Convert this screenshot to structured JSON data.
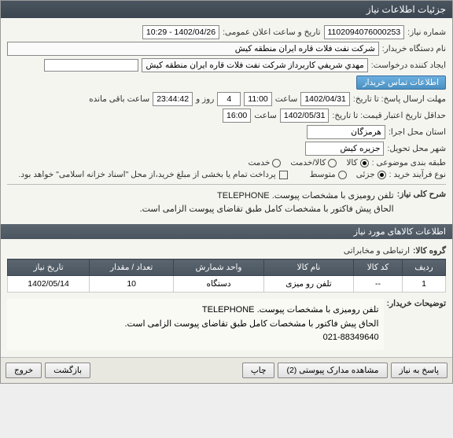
{
  "titlebar": "جزئیات اطلاعات نیاز",
  "labels": {
    "need_no": "شماره نیاز:",
    "announce_date": "تاریخ و ساعت اعلان عمومی:",
    "buyer_org": "نام دستگاه خریدار:",
    "requester": "ایجاد کننده درخواست:",
    "contact_btn": "اطلاعات تماس خریدار",
    "deadline": "مهلت ارسال پاسخ: تا تاریخ:",
    "hour": "ساعت",
    "days_and": "روز و",
    "hours_remain": "ساعت باقی مانده",
    "validity": "حداقل تاریخ اعتبار قیمت: تا تاریخ:",
    "exec_province": "استان محل اجرا:",
    "delivery_city": "شهر محل تحویل:",
    "subject_class": "طبقه بندی موضوعی :",
    "goods": "کالا",
    "service": "کالا/خدمت",
    "service2": "خدمت",
    "purchase_type": "نوع فرآیند خرید :",
    "partial": "جزئی",
    "medium": "متوسط",
    "payment_note": "پرداخت تمام یا بخشی از مبلغ خرید،از محل \"اسناد خزانه اسلامی\" خواهد بود.",
    "summary_label": "شرح کلی نیاز:",
    "section_items": "اطلاعات کالاهای مورد نیاز",
    "group_label": "گروه کالا:",
    "buyer_notes_label": "توضیحات خریدار:"
  },
  "values": {
    "need_no": "1102094076000253",
    "announce_date": "1402/04/26 - 10:29",
    "buyer_org": "شرکت نفت فلات قاره ایران منطقه کیش",
    "requester": "مهدي شريفي كاربرداز شركت نفت فلات قاره ایران منطقه کیش",
    "deadline_date": "1402/04/31",
    "deadline_time": "11:00",
    "days": "4",
    "hours": "23:44:42",
    "validity_date": "1402/05/31",
    "validity_time": "16:00",
    "province": "هرمزگان",
    "city": "جزیره کیش",
    "summary1": "تلفن رومیزی با مشخصات پیوست. TELEPHONE",
    "summary2": "الحاق پیش فاکتور با مشخصات کامل طبق تقاضای پیوست الزامی است.",
    "group": "ارتباطی و مخابراتی",
    "buyer_notes1": "تلفن رومیزی با مشخصات پیوست. TELEPHONE",
    "buyer_notes2": "الحاق پیش فاکتور با مشخصات کامل طبق تقاضای پیوست الزامی است.",
    "buyer_notes3": "021-88349640"
  },
  "table": {
    "headers": [
      "ردیف",
      "کد کالا",
      "نام کالا",
      "واحد شمارش",
      "تعداد / مقدار",
      "تاریخ نیاز"
    ],
    "row": [
      "1",
      "--",
      "تلفن رو میزی",
      "دستگاه",
      "10",
      "1402/05/14"
    ]
  },
  "buttons": {
    "respond": "پاسخ به نیاز",
    "attachments": "مشاهده مدارک پیوستی (2)",
    "print": "چاپ",
    "back": "بازگشت",
    "exit": "خروج"
  }
}
